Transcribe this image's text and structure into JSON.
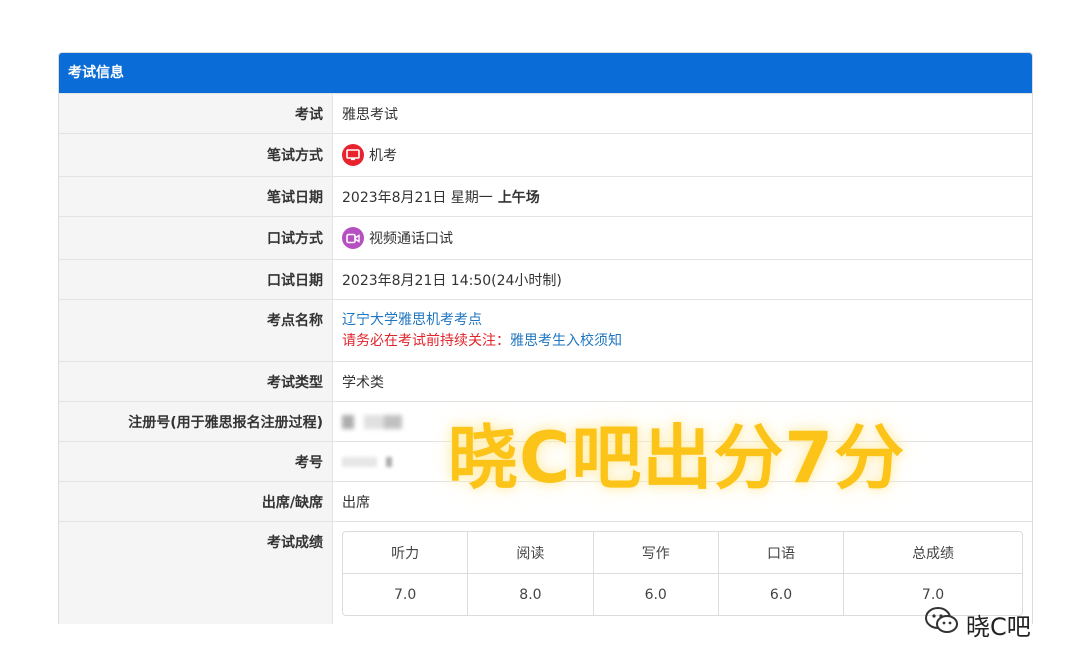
{
  "panel": {
    "title": "考试信息"
  },
  "rows": [
    {
      "label": "考试",
      "value": "雅思考试"
    },
    {
      "label": "笔试方式",
      "value": "机考",
      "icon": "monitor-icon",
      "icon_color": "#e8232e"
    },
    {
      "label": "笔试日期",
      "date": "2023年8月21日 星期一",
      "session": "上午场"
    },
    {
      "label": "口试方式",
      "value": "视频通话口试",
      "icon": "video-camera-icon",
      "icon_color": "#b64fc1"
    },
    {
      "label": "口试日期",
      "value": "2023年8月21日 14:50(24小时制)"
    },
    {
      "label": "考点名称",
      "link": "辽宁大学雅思机考考点",
      "notice": "请务必在考试前持续关注：",
      "notice_link": "雅思考生入校须知"
    },
    {
      "label": "考试类型",
      "value": "学术类"
    },
    {
      "label": "注册号(用于雅思报名注册过程)",
      "value": ""
    },
    {
      "label": "考号",
      "value": ""
    },
    {
      "label": "出席/缺席",
      "value": "出席"
    },
    {
      "label": "考试成绩"
    }
  ],
  "scores": {
    "headers": [
      "听力",
      "阅读",
      "写作",
      "口语",
      "总成绩"
    ],
    "values": [
      "7.0",
      "8.0",
      "6.0",
      "6.0",
      "7.0"
    ]
  },
  "overlay": {
    "text": "晓C吧出分7分",
    "color": "#fcc419"
  },
  "signature": {
    "text": "晓C吧"
  },
  "colors": {
    "header_bg": "#0a6cd6",
    "link": "#1f76c0",
    "notice": "#e0242c"
  }
}
